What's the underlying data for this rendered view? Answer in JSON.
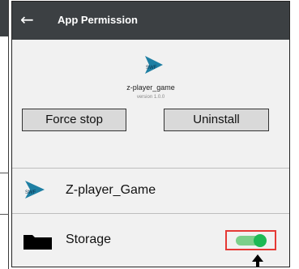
{
  "appbar": {
    "back_icon": "←",
    "title": "App Permission"
  },
  "app": {
    "logo_text": "SWF",
    "name": "z-player_game",
    "version": "version 1.0.0"
  },
  "actions": {
    "force_stop_label": "Force stop",
    "uninstall_label": "Uninstall"
  },
  "rows": [
    {
      "icon": "swf-app-icon",
      "icon_text": "SWF",
      "label": "Z-player_Game"
    },
    {
      "icon": "folder-icon",
      "label": "Storage",
      "toggle_on": true
    }
  ],
  "colors": {
    "appbar_bg": "#3c4043",
    "toggle_track": "#7ccf8a",
    "toggle_knob": "#1db954",
    "highlight": "#e53935",
    "logo": "#1e7fa3"
  }
}
